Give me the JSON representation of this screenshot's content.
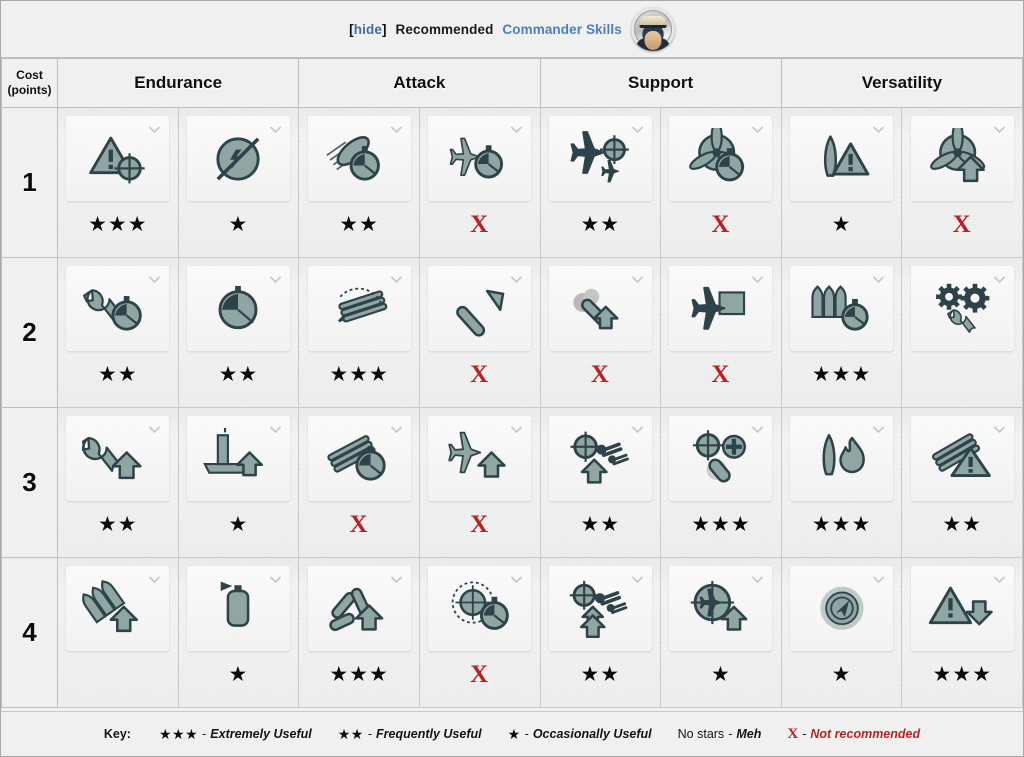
{
  "header": {
    "hide_label": "hide",
    "bracket_open": "[",
    "bracket_close": "]",
    "title_plain": "Recommended",
    "title_link": "Commander Skills",
    "avatar_name": "commander-portrait",
    "link_color": "#4a7fbf"
  },
  "table": {
    "cost_header_line1": "Cost",
    "cost_header_line2": "(points)",
    "columns": [
      "Endurance",
      "Attack",
      "Support",
      "Versatility"
    ],
    "rows": [
      {
        "cost": "1",
        "cells": [
          {
            "icon": "warning-triangle-crosshair-icon",
            "rating": "★★★",
            "type": "stars"
          },
          {
            "icon": "no-detonation-circle-icon",
            "rating": "★",
            "type": "stars"
          },
          {
            "icon": "ship-speed-stopwatch-icon",
            "rating": "★★",
            "type": "stars"
          },
          {
            "icon": "plane-stopwatch-icon",
            "rating": "X",
            "type": "x"
          },
          {
            "icon": "plane-crosshair-icon",
            "rating": "★★",
            "type": "stars"
          },
          {
            "icon": "propeller-stopwatch-icon",
            "rating": "X",
            "type": "x"
          },
          {
            "icon": "torpedo-warning-icon",
            "rating": "★",
            "type": "stars"
          },
          {
            "icon": "propeller-boost-arrow-icon",
            "rating": "X",
            "type": "x"
          }
        ]
      },
      {
        "cost": "2",
        "cells": [
          {
            "icon": "wrench-stopwatch-icon",
            "rating": "★★",
            "type": "stars"
          },
          {
            "icon": "stopwatch-icon",
            "rating": "★★",
            "type": "stars"
          },
          {
            "icon": "turret-traverse-icon",
            "rating": "★★★",
            "type": "stars"
          },
          {
            "icon": "torpedo-arrow-icon",
            "rating": "X",
            "type": "x"
          },
          {
            "icon": "smoke-shell-boost-icon",
            "rating": "X",
            "type": "x"
          },
          {
            "icon": "plane-hangar-icon",
            "rating": "X",
            "type": "x"
          },
          {
            "icon": "shells-stopwatch-icon",
            "rating": "★★★",
            "type": "stars"
          },
          {
            "icon": "gears-wrench-icon",
            "rating": "",
            "type": "none"
          }
        ]
      },
      {
        "cost": "3",
        "cells": [
          {
            "icon": "wrench-up-arrow-icon",
            "rating": "★★",
            "type": "stars"
          },
          {
            "icon": "carrier-up-arrow-icon",
            "rating": "★",
            "type": "stars"
          },
          {
            "icon": "guns-stopwatch-icon",
            "rating": "X",
            "type": "x"
          },
          {
            "icon": "plane-up-arrow-icon",
            "rating": "X",
            "type": "x"
          },
          {
            "icon": "aa-crosshair-boost-icon",
            "rating": "★★",
            "type": "stars"
          },
          {
            "icon": "aa-plus-extinguisher-icon",
            "rating": "★★★",
            "type": "stars"
          },
          {
            "icon": "torpedo-fire-icon",
            "rating": "★★★",
            "type": "stars"
          },
          {
            "icon": "guns-warning-icon",
            "rating": "★★",
            "type": "stars"
          }
        ]
      },
      {
        "cost": "4",
        "cells": [
          {
            "icon": "shells-boost-arrow-icon",
            "rating": "",
            "type": "none"
          },
          {
            "icon": "smoke-generator-icon",
            "rating": "★",
            "type": "stars"
          },
          {
            "icon": "torpedo-spread-boost-icon",
            "rating": "★★★",
            "type": "stars"
          },
          {
            "icon": "radar-stopwatch-icon",
            "rating": "X",
            "type": "x"
          },
          {
            "icon": "aa-crosshair-double-boost-icon",
            "rating": "★★",
            "type": "stars"
          },
          {
            "icon": "plane-target-boost-icon",
            "rating": "★",
            "type": "stars"
          },
          {
            "icon": "sonar-ping-icon",
            "rating": "★",
            "type": "stars"
          },
          {
            "icon": "warning-down-arrow-icon",
            "rating": "★★★",
            "type": "stars"
          }
        ]
      }
    ]
  },
  "key": {
    "label": "Key:",
    "items": [
      {
        "sym": "★★★",
        "dash": "-",
        "text": "Extremely Useful",
        "red": false,
        "plain": false
      },
      {
        "sym": "★★",
        "dash": "-",
        "text": "Frequently Useful",
        "red": false,
        "plain": false
      },
      {
        "sym": "★",
        "dash": "-",
        "text": "Occasionally Useful",
        "red": false,
        "plain": false
      },
      {
        "sym": "No stars",
        "dash": "-",
        "text": "Meh",
        "red": false,
        "plain": true
      },
      {
        "sym": "X",
        "dash": "-",
        "text": "Not recommended",
        "red": true,
        "plain": false
      }
    ]
  },
  "colors": {
    "icon_dark": "#2e4249",
    "icon_mid": "#8fa6a3",
    "x_red": "#b52424",
    "link": "#4a7fbf",
    "border": "#bdbdbd"
  }
}
